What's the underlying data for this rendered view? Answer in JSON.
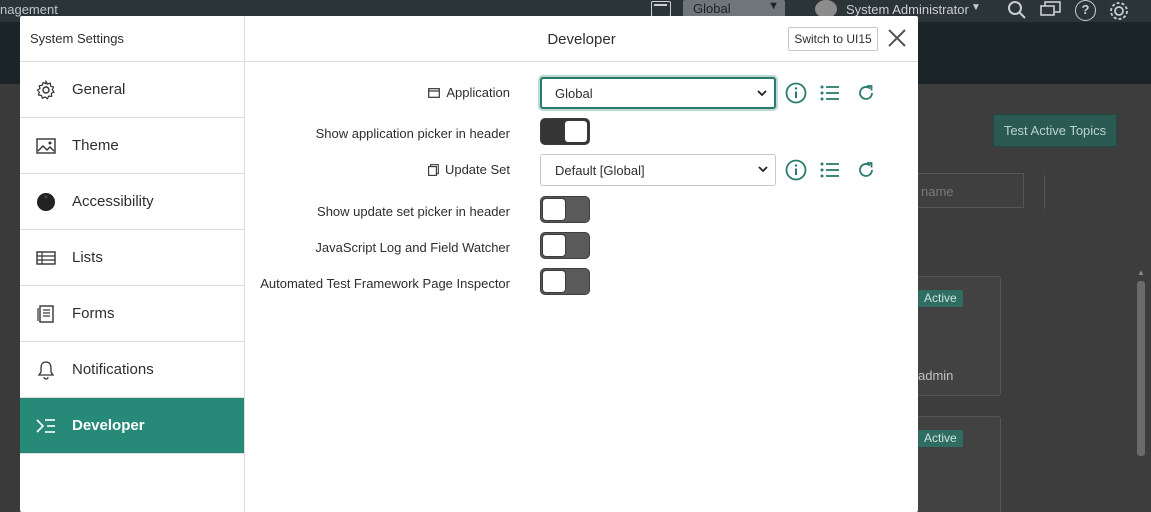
{
  "background": {
    "title": "nagement",
    "scope_select": "Global",
    "user_name": "System Administrator",
    "test_topics_button": "Test Active Topics",
    "search_placeholder": "name",
    "badges": [
      "Active",
      "Active"
    ],
    "card_user": "admin"
  },
  "modal": {
    "sidebar_title": "System Settings",
    "nav_items": [
      {
        "label": "General",
        "icon": "gear-icon"
      },
      {
        "label": "Theme",
        "icon": "image-icon"
      },
      {
        "label": "Accessibility",
        "icon": "accessibility-icon"
      },
      {
        "label": "Lists",
        "icon": "list-table-icon"
      },
      {
        "label": "Forms",
        "icon": "form-icon"
      },
      {
        "label": "Notifications",
        "icon": "bell-icon"
      },
      {
        "label": "Developer",
        "icon": "developer-icon",
        "active": true
      }
    ],
    "title": "Developer",
    "switch_button": "Switch to UI15",
    "settings": {
      "application_label": "Application",
      "application_value": "Global",
      "show_app_picker_label": "Show application picker in header",
      "show_app_picker_on": true,
      "update_set_label": "Update Set",
      "update_set_value": "Default [Global]",
      "show_update_set_picker_label": "Show update set picker in header",
      "show_update_set_picker_on": false,
      "js_log_label": "JavaScript Log and Field Watcher",
      "js_log_on": false,
      "atf_inspector_label": "Automated Test Framework Page Inspector",
      "atf_inspector_on": false
    },
    "accent_color": "#278a79"
  }
}
